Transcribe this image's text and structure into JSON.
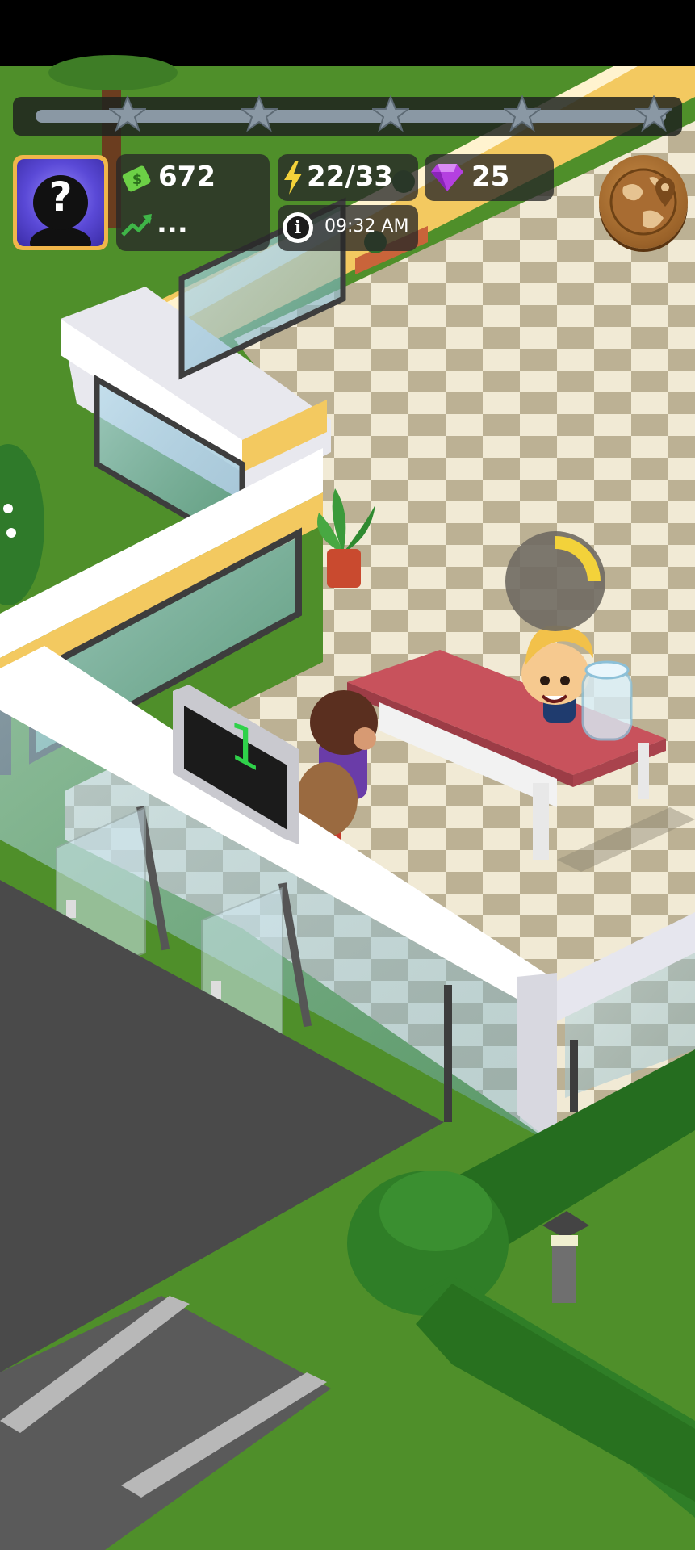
{
  "hud": {
    "cash": "672",
    "income": "...",
    "energy": "22/33",
    "time": "09:32 AM",
    "gems": "25",
    "avatar_glyph": "?",
    "level_stars_total": 5
  },
  "scene": {
    "queue_number": "1",
    "service_progress": 0.25
  },
  "colors": {
    "grass": "#4f8f2a",
    "floor_light": "#efe8d2",
    "floor_dark": "#b9ae92",
    "desk_top": "#c8525c",
    "accent_gold": "#f0b64a",
    "gem": "#b440e0",
    "cash_icon": "#6cd046"
  },
  "icons": [
    "cash-icon",
    "income-trend-icon",
    "energy-bolt-icon",
    "gem-icon",
    "info-icon",
    "world-map-icon",
    "star-icon",
    "unknown-avatar-icon"
  ]
}
